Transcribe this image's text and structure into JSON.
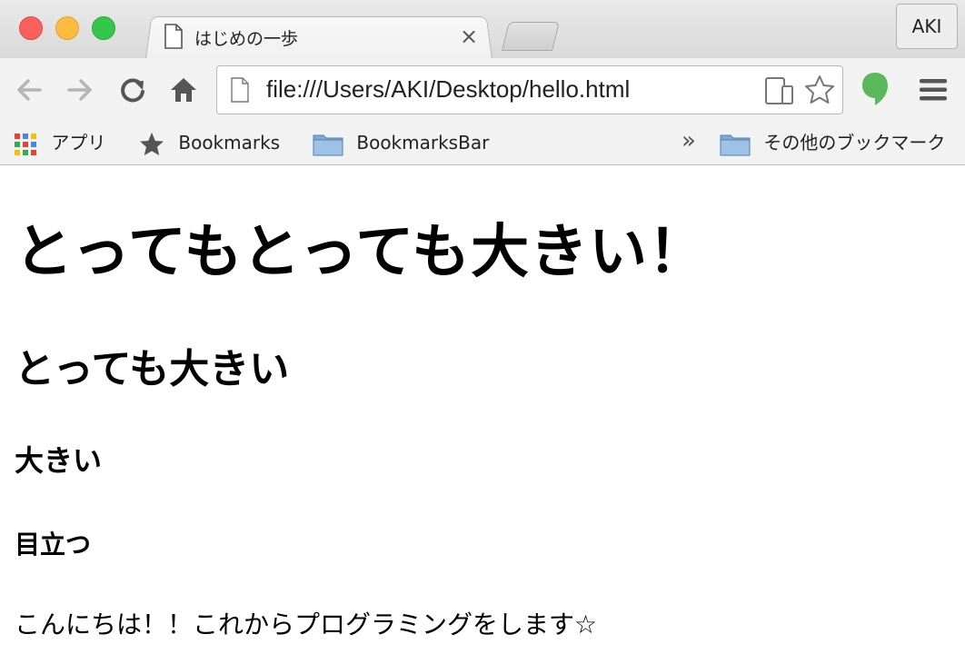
{
  "tab": {
    "title": "はじめの一歩",
    "close_glyph": "×"
  },
  "profile": {
    "label": "AKI"
  },
  "toolbar": {
    "back_icon": "back-arrow-icon",
    "forward_icon": "forward-arrow-icon",
    "reload_icon": "reload-icon",
    "home_icon": "home-icon",
    "url": "file:///Users/AKI/Desktop/hello.html",
    "star_icon": "bookmark-star-icon",
    "menu_icon": "hamburger-menu-icon"
  },
  "bookmarks_bar": {
    "apps_label": "アプリ",
    "items": [
      {
        "label": "Bookmarks",
        "icon": "star-icon"
      },
      {
        "label": "BookmarksBar",
        "icon": "folder-icon"
      }
    ],
    "overflow_glyph": "»",
    "other_label": "その他のブックマーク"
  },
  "page": {
    "h1": "とってもとっても大きい！",
    "h2": "とっても大きい",
    "h3": "大きい",
    "h4": "目立つ",
    "paragraph": "こんにちは！！これからプログラミングをします☆"
  },
  "colors": {
    "close_red": "#fc605c",
    "minimize_yellow": "#fdbc40",
    "zoom_green": "#34c84a",
    "extension_green": "#5cb85c"
  }
}
